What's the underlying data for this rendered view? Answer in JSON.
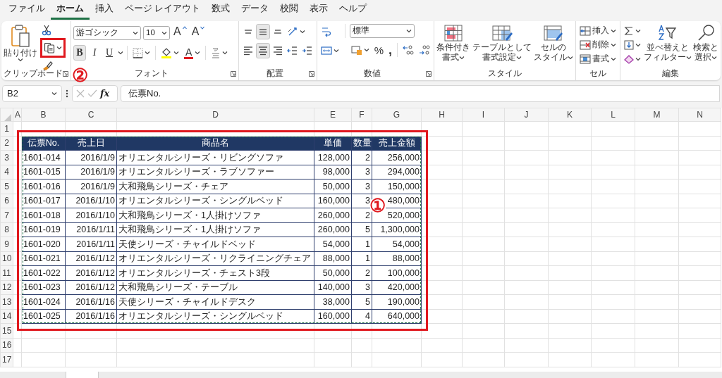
{
  "menu_tabs": [
    {
      "label": "ファイル",
      "selected": false
    },
    {
      "label": "ホーム",
      "selected": true
    },
    {
      "label": "挿入",
      "selected": false
    },
    {
      "label": "ページ レイアウト",
      "selected": false
    },
    {
      "label": "数式",
      "selected": false
    },
    {
      "label": "データ",
      "selected": false
    },
    {
      "label": "校閲",
      "selected": false
    },
    {
      "label": "表示",
      "selected": false
    },
    {
      "label": "ヘルプ",
      "selected": false
    }
  ],
  "ribbon": {
    "clipboard": {
      "paste_label": "貼り付け",
      "group_label": "クリップボード"
    },
    "font": {
      "font_name": "游ゴシック",
      "font_size": "10",
      "size_buttons": [
        "A",
        "A"
      ],
      "styles": [
        {
          "label": "B",
          "selected": true
        },
        {
          "label": "I",
          "selected": false
        },
        {
          "label": "U",
          "selected": false
        }
      ],
      "font_color_label": "A",
      "group_label": "フォント"
    },
    "alignment": {
      "vertical": [
        {
          "kind": "top",
          "selected": false
        },
        {
          "kind": "middle",
          "selected": true
        },
        {
          "kind": "bottom",
          "selected": false
        }
      ],
      "horizontal": [
        {
          "kind": "left",
          "selected": false
        },
        {
          "kind": "center",
          "selected": true
        },
        {
          "kind": "right",
          "selected": false
        }
      ],
      "group_label": "配置"
    },
    "number": {
      "format": "標準",
      "symbols": [
        "%",
        ","
      ],
      "group_label": "数値"
    },
    "styles": {
      "buttons": [
        [
          "条件付き",
          "書式"
        ],
        [
          "テーブルとして",
          "書式設定"
        ],
        [
          "セルの",
          "スタイル"
        ]
      ],
      "group_label": "スタイル"
    },
    "cells": {
      "buttons": [
        "挿入",
        "削除",
        "書式"
      ],
      "group_label": "セル"
    },
    "editing": {
      "buttons": [
        [
          "並べ替えと",
          "フィルター"
        ],
        [
          "検索と",
          "選択"
        ]
      ],
      "group_label": "編集"
    }
  },
  "formula_bar": {
    "name_box": "B2",
    "function_label": "fx",
    "formula": "伝票No."
  },
  "sheet": {
    "columns": [
      "A",
      "B",
      "C",
      "D",
      "E",
      "F",
      "G",
      "H",
      "I",
      "J",
      "K",
      "L",
      "M",
      "N"
    ],
    "rows": [
      "1",
      "2",
      "3",
      "4",
      "5",
      "6",
      "7",
      "8",
      "9",
      "10",
      "11",
      "12",
      "13",
      "14",
      "15",
      "16",
      "17"
    ],
    "table": {
      "headers": [
        "伝票No.",
        "売上日",
        "商品名",
        "単価",
        "数量",
        "売上金額"
      ],
      "rows": [
        [
          "1601-014",
          "2016/1/9",
          "オリエンタルシリーズ・リビングソファ",
          "128,000",
          "2",
          "256,000"
        ],
        [
          "1601-015",
          "2016/1/9",
          "オリエンタルシリーズ・ラブソファー",
          "98,000",
          "3",
          "294,000"
        ],
        [
          "1601-016",
          "2016/1/9",
          "大和飛鳥シリーズ・チェア",
          "50,000",
          "3",
          "150,000"
        ],
        [
          "1601-017",
          "2016/1/10",
          "オリエンタルシリーズ・シングルベッド",
          "160,000",
          "3",
          "480,000"
        ],
        [
          "1601-018",
          "2016/1/10",
          "大和飛鳥シリーズ・1人掛けソファ",
          "260,000",
          "2",
          "520,000"
        ],
        [
          "1601-019",
          "2016/1/11",
          "大和飛鳥シリーズ・1人掛けソファ",
          "260,000",
          "5",
          "1,300,000"
        ],
        [
          "1601-020",
          "2016/1/11",
          "天使シリーズ・チャイルドベッド",
          "54,000",
          "1",
          "54,000"
        ],
        [
          "1601-021",
          "2016/1/12",
          "オリエンタルシリーズ・リクライニングチェア",
          "88,000",
          "1",
          "88,000"
        ],
        [
          "1601-022",
          "2016/1/12",
          "オリエンタルシリーズ・チェスト3段",
          "50,000",
          "2",
          "100,000"
        ],
        [
          "1601-023",
          "2016/1/12",
          "大和飛鳥シリーズ・テーブル",
          "140,000",
          "3",
          "420,000"
        ],
        [
          "1601-024",
          "2016/1/16",
          "天使シリーズ・チャイルドデスク",
          "38,000",
          "5",
          "190,000"
        ],
        [
          "1601-025",
          "2016/1/16",
          "オリエンタルシリーズ・シングルベッド",
          "160,000",
          "4",
          "640,000"
        ]
      ]
    }
  },
  "annotations": {
    "range_marker": "①",
    "copy_marker": "②"
  }
}
